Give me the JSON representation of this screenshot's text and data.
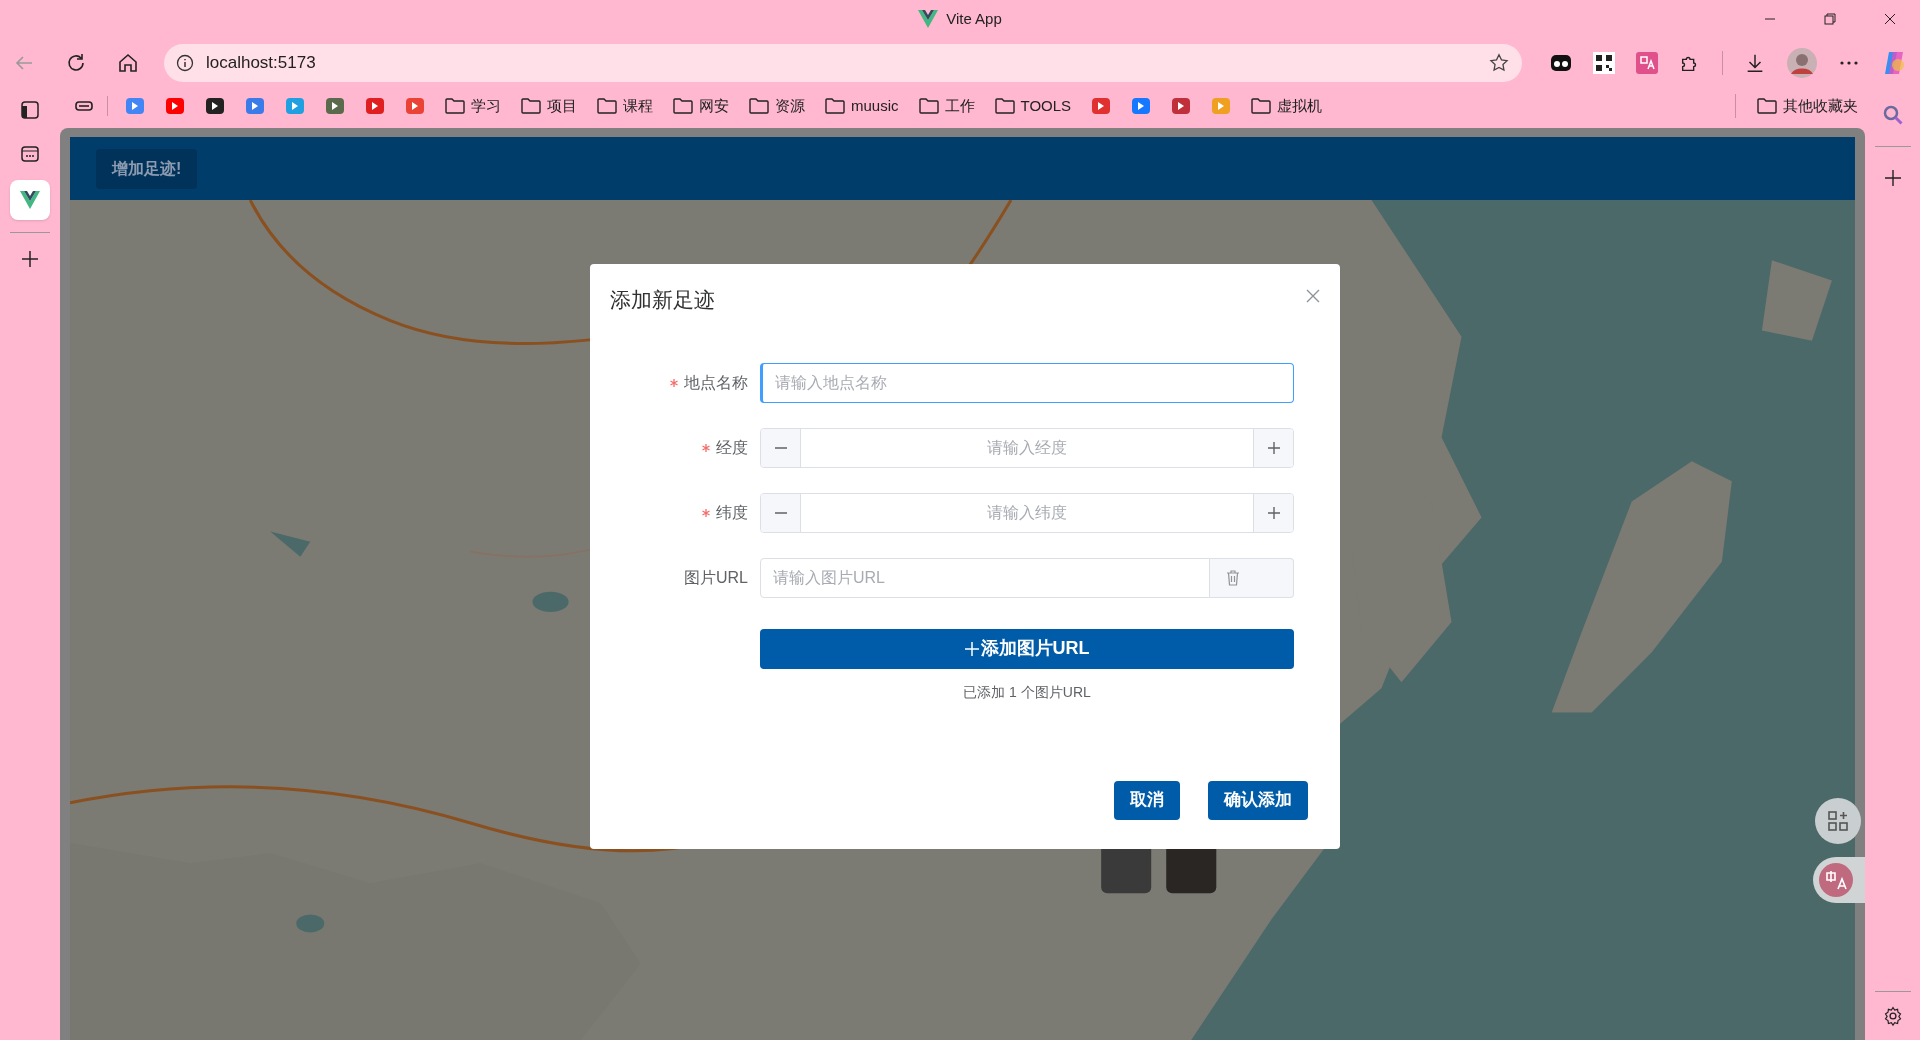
{
  "window": {
    "title": "Vite App"
  },
  "address_bar": {
    "url": "localhost:5173"
  },
  "bookmarks": [
    {
      "kind": "site",
      "color": "#4285f4"
    },
    {
      "kind": "site",
      "color": "#ff0000"
    },
    {
      "kind": "site",
      "color": "#222222"
    },
    {
      "kind": "site",
      "color": "#3b7be8"
    },
    {
      "kind": "site",
      "color": "#20a0e0"
    },
    {
      "kind": "site",
      "color": "#5a6a4a"
    },
    {
      "kind": "site",
      "color": "#e02020"
    },
    {
      "kind": "site",
      "color": "#ea4335"
    },
    {
      "kind": "folder",
      "label": "学习"
    },
    {
      "kind": "folder",
      "label": "项目"
    },
    {
      "kind": "folder",
      "label": "课程"
    },
    {
      "kind": "folder",
      "label": "网安"
    },
    {
      "kind": "folder",
      "label": "资源"
    },
    {
      "kind": "folder",
      "label": "muusic"
    },
    {
      "kind": "folder",
      "label": "工作"
    },
    {
      "kind": "folder",
      "label": "TOOLS"
    },
    {
      "kind": "site",
      "color": "#e03030"
    },
    {
      "kind": "site",
      "color": "#1677ff"
    },
    {
      "kind": "site",
      "color": "#c0303a"
    },
    {
      "kind": "site",
      "color": "#f0a020"
    },
    {
      "kind": "folder",
      "label": "虚拟机"
    }
  ],
  "other_bookmarks": "其他收藏夹",
  "page": {
    "header_button": "增加足迹!"
  },
  "dialog": {
    "title": "添加新足迹",
    "fields": [
      {
        "kind": "text",
        "label": "地点名称",
        "required": true,
        "placeholder": "请输入地点名称",
        "focused": true
      },
      {
        "kind": "number",
        "label": "经度",
        "required": true,
        "placeholder": "请输入经度",
        "focused": false
      },
      {
        "kind": "number",
        "label": "纬度",
        "required": true,
        "placeholder": "请输入纬度",
        "focused": false
      },
      {
        "kind": "url",
        "label": "图片URL",
        "required": false,
        "placeholder": "请输入图片URL",
        "focused": false
      }
    ],
    "add_button": "添加图片URL",
    "hint": "已添加 1 个图片URL",
    "buttons": [
      "取消",
      "确认添加"
    ]
  }
}
